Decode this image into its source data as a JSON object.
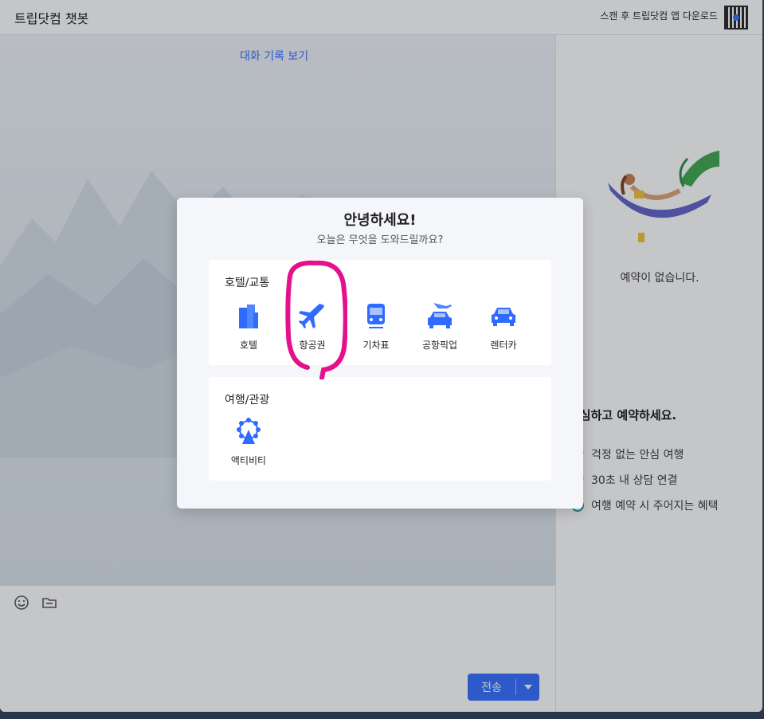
{
  "header": {
    "app_title": "트립닷컴 챗봇",
    "download_text": "스캔 후 트립닷컴 앱 다운로드"
  },
  "chat": {
    "history_link": "대화 기록 보기"
  },
  "input": {
    "send_label": "전송"
  },
  "right_panel": {
    "no_booking": "예약이 없습니다.",
    "promo_title": "안심하고 예약하세요.",
    "promo_items": [
      "걱정 없는 안심 여행",
      "30초 내 상담 연결",
      "여행 예약 시 주어지는 혜택"
    ]
  },
  "modal": {
    "title": "안녕하세요!",
    "subtitle": "오늘은 무엇을 도와드릴까요?",
    "sections": [
      {
        "title": "호텔/교통",
        "items": [
          {
            "label": "호텔",
            "icon": "hotel-icon"
          },
          {
            "label": "항공권",
            "icon": "airplane-icon"
          },
          {
            "label": "기차표",
            "icon": "train-icon"
          },
          {
            "label": "공항픽업",
            "icon": "airport-pickup-icon"
          },
          {
            "label": "렌터카",
            "icon": "car-rental-icon"
          }
        ]
      },
      {
        "title": "여행/관광",
        "items": [
          {
            "label": "액티비티",
            "icon": "ferris-wheel-icon"
          }
        ]
      }
    ]
  },
  "colors": {
    "accent": "#2f6bff",
    "highlight_annotation": "#e5108c"
  }
}
